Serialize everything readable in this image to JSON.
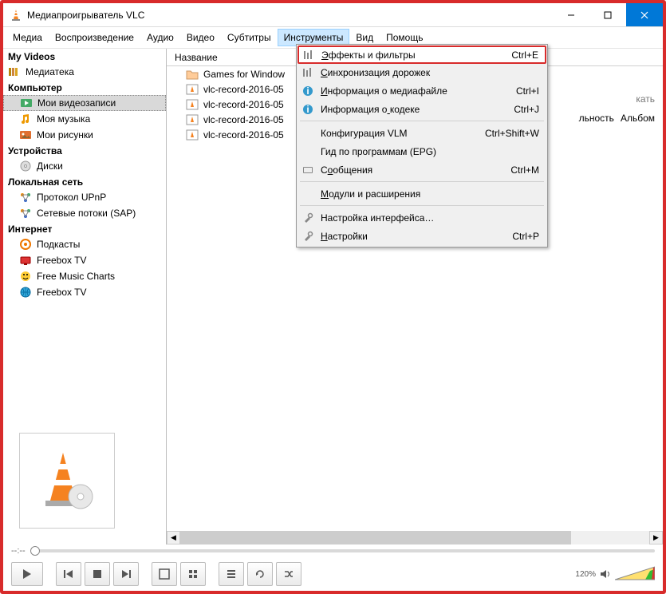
{
  "title": "Медиапроигрыватель VLC",
  "menubar": [
    "Медиа",
    "Воспроизведение",
    "Аудио",
    "Видео",
    "Субтитры",
    "Инструменты",
    "Вид",
    "Помощь"
  ],
  "menubar_open_index": 5,
  "sidebar": {
    "my_videos": "My Videos",
    "mediateka": "Медиатека",
    "computer": "Компьютер",
    "my_video_rec": "Мои видеозаписи",
    "my_music": "Моя музыка",
    "my_pictures": "Мои рисунки",
    "devices": "Устройства",
    "discs": "Диски",
    "lan": "Локальная сеть",
    "upnp": "Протокол UPnP",
    "sap": "Сетевые потоки (SAP)",
    "internet": "Интернет",
    "podcasts": "Подкасты",
    "freebox1": "Freebox TV",
    "fmc": "Free Music Charts",
    "freebox2": "Freebox TV"
  },
  "list": {
    "header_name": "Название",
    "col_length": "льность",
    "col_album": "Альбом",
    "search_tail": "кать",
    "rows": [
      {
        "icon": "folder",
        "name": "Games for Window"
      },
      {
        "icon": "vlc",
        "name": "vlc-record-2016-05"
      },
      {
        "icon": "vlc",
        "name": "vlc-record-2016-05"
      },
      {
        "icon": "vlc",
        "name": "vlc-record-2016-05"
      },
      {
        "icon": "vlc",
        "name": "vlc-record-2016-05"
      }
    ]
  },
  "dropdown": [
    {
      "icon": "equalizer",
      "label": "Эффекты и фильтры",
      "shortcut": "Ctrl+E",
      "hl": true,
      "u": 0
    },
    {
      "icon": "equalizer",
      "label": "Синхронизация дорожек",
      "shortcut": "",
      "u": 0
    },
    {
      "icon": "info",
      "label": "Информация о медиафайле",
      "shortcut": "Ctrl+I",
      "u": 0
    },
    {
      "icon": "info",
      "label": "Информация о кодеке",
      "shortcut": "Ctrl+J",
      "u": 12
    },
    {
      "sep": true
    },
    {
      "icon": "",
      "label": "Конфигурация VLM",
      "shortcut": "Ctrl+Shift+W",
      "u": -1
    },
    {
      "icon": "",
      "label": "Гид по программам (EPG)",
      "shortcut": "",
      "u": -1
    },
    {
      "icon": "msgs",
      "label": "Сообщения",
      "shortcut": "Ctrl+M",
      "u": 1
    },
    {
      "sep": true
    },
    {
      "icon": "",
      "label": "Модули и расширения",
      "shortcut": "",
      "u": 0
    },
    {
      "sep": true
    },
    {
      "icon": "tools",
      "label": "Настройка интерфейса…",
      "shortcut": "",
      "u": -1
    },
    {
      "icon": "tools",
      "label": "Настройки",
      "shortcut": "Ctrl+P",
      "u": 0
    }
  ],
  "seek_time": "--:--",
  "volume": "120%"
}
